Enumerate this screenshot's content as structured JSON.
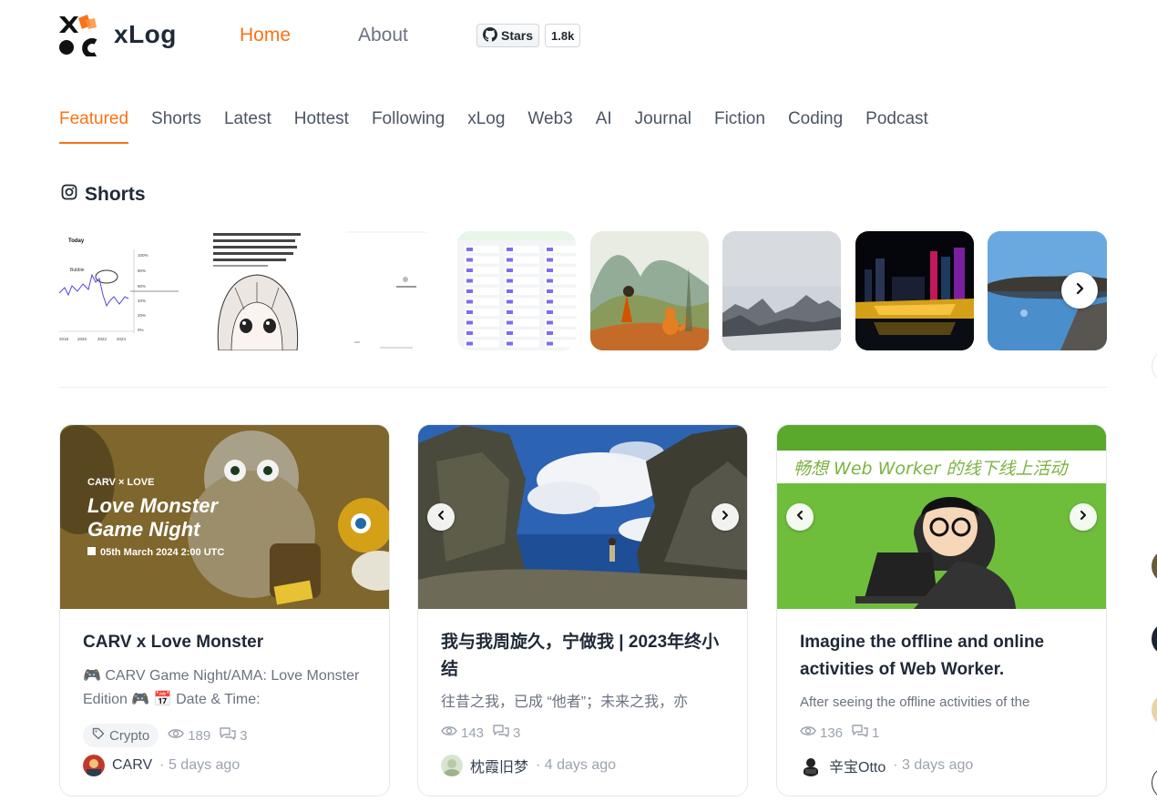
{
  "header": {
    "brand": "xLog",
    "nav": {
      "home": "Home",
      "about": "About"
    },
    "github": {
      "stars_label": "Stars",
      "stars_count": "1.8k"
    },
    "accent_color": "#f97316"
  },
  "tabs": [
    "Featured",
    "Shorts",
    "Latest",
    "Hottest",
    "Following",
    "xLog",
    "Web3",
    "AI",
    "Journal",
    "Fiction",
    "Coding",
    "Podcast"
  ],
  "active_tab": "Featured",
  "shorts": {
    "title": "Shorts",
    "icon": "instagram-icon",
    "thumbnails": [
      {
        "name": "chart-thumbnail",
        "texts": [
          "Today",
          "Bubble",
          "100%",
          "80%",
          "60%",
          "40%",
          "20%",
          "0%",
          "2018",
          "2020",
          "2022",
          "2024"
        ]
      },
      {
        "name": "anime-girl-thumbnail"
      },
      {
        "name": "screenshot-thumbnail"
      },
      {
        "name": "table-screenshot-thumbnail"
      },
      {
        "name": "watercolor-fox-thumbnail"
      },
      {
        "name": "misty-mountains-thumbnail"
      },
      {
        "name": "city-night-thumbnail"
      },
      {
        "name": "lake-reflection-thumbnail"
      }
    ],
    "next_icon": "chevron-right-icon"
  },
  "cards": [
    {
      "cover_text": {
        "brand_line": "CARV × LOVE",
        "title_line1": "Love Monster",
        "title_line2": "Game Night",
        "date": "05th March 2024 2:00 UTC"
      },
      "title": "CARV x Love Monster",
      "excerpt": "🎮 CARV Game Night/AMA: Love Monster Edition 🎮 📅 Date & Time:",
      "tag": "Crypto",
      "views": "189",
      "comments": "3",
      "author": "CARV",
      "time": "· 5 days ago"
    },
    {
      "title": "我与我周旋久，宁做我 | 2023年终小结",
      "excerpt": "往昔之我，已成 “他者”；未来之我，亦",
      "views": "143",
      "comments": "3",
      "author": "枕霞旧梦",
      "time": "· 4 days ago"
    },
    {
      "cover_text": {
        "banner": "畅想 Web Worker 的线下线上活动"
      },
      "title": "Imagine the offline and online activities of Web Worker.",
      "excerpt": "After seeing the offline activities of the",
      "views": "136",
      "comments": "1",
      "author": "辛宝Otto",
      "time": "· 3 days ago"
    }
  ]
}
